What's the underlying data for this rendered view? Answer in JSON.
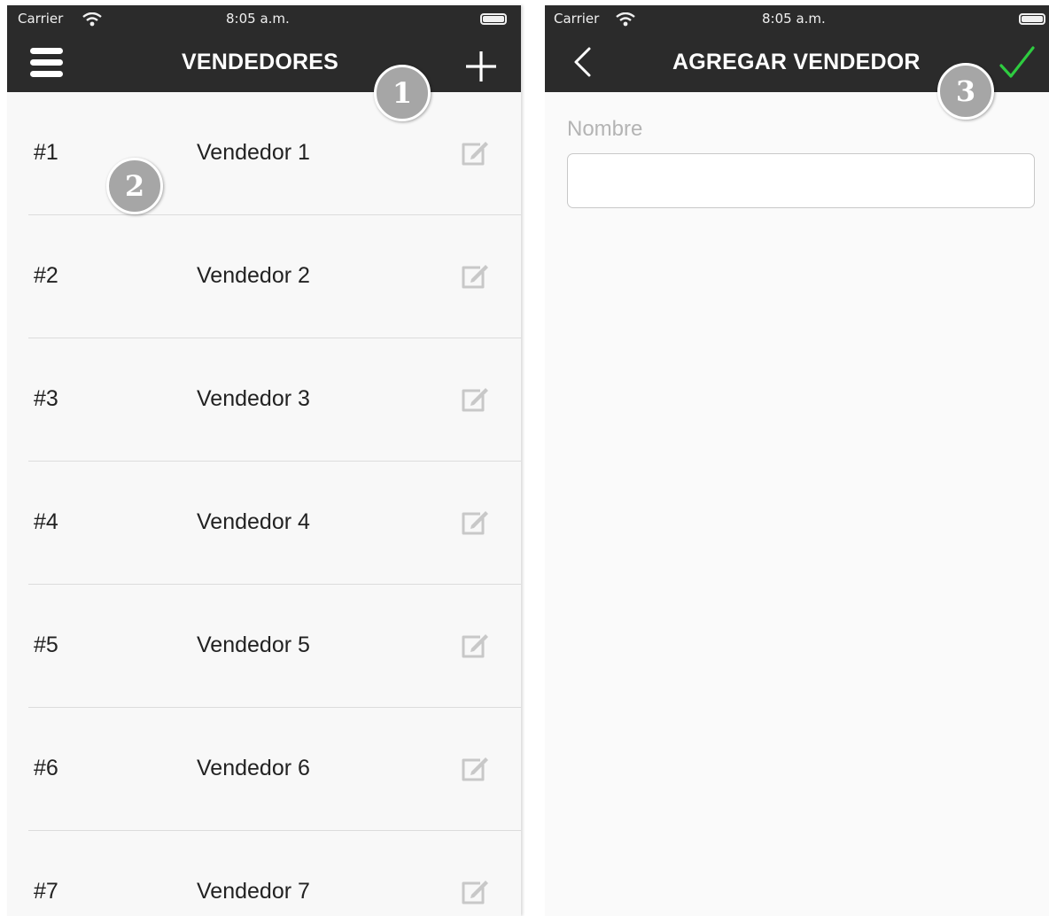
{
  "left_screen": {
    "status": {
      "carrier": "Carrier",
      "time": "8:05 a.m."
    },
    "title": "VENDEDORES",
    "icons": {
      "menu": "menu-icon",
      "add": "plus-icon",
      "edit": "edit-icon"
    },
    "rows": [
      {
        "number": "#1",
        "name": "Vendedor 1"
      },
      {
        "number": "#2",
        "name": "Vendedor 2"
      },
      {
        "number": "#3",
        "name": "Vendedor 3"
      },
      {
        "number": "#4",
        "name": "Vendedor 4"
      },
      {
        "number": "#5",
        "name": "Vendedor 5"
      },
      {
        "number": "#6",
        "name": "Vendedor 6"
      },
      {
        "number": "#7",
        "name": "Vendedor 7"
      }
    ]
  },
  "right_screen": {
    "status": {
      "carrier": "Carrier",
      "time": "8:05 a.m."
    },
    "title": "AGREGAR VENDEDOR",
    "icons": {
      "back": "chevron-left-icon",
      "confirm": "checkmark-icon"
    },
    "form": {
      "name_label": "Nombre",
      "name_value": ""
    }
  },
  "callouts": [
    "1",
    "2",
    "3"
  ],
  "colors": {
    "header_bg": "#2b2b2b",
    "confirm_green": "#2ecc40",
    "callout_gray": "#a6a6a6"
  }
}
